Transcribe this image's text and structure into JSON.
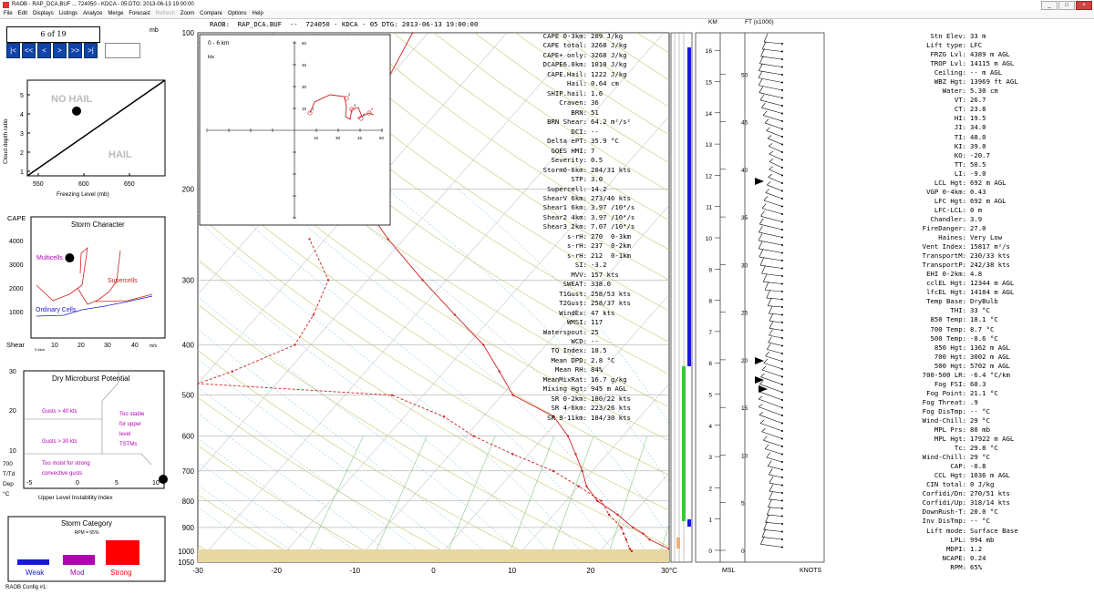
{
  "window": {
    "title": "RAOB - RAP_DCA.BUF ...  724050 - KDCA - 05  DTG: 2013-06-13 19:00:00",
    "controls": [
      "_",
      "□",
      "×"
    ]
  },
  "menu": [
    {
      "label": "File",
      "enabled": true
    },
    {
      "label": "Edit",
      "enabled": true
    },
    {
      "label": "Displays",
      "enabled": true
    },
    {
      "label": "Listings",
      "enabled": true
    },
    {
      "label": "Analyze",
      "enabled": true
    },
    {
      "label": "Merge",
      "enabled": true
    },
    {
      "label": "Forecast",
      "enabled": true
    },
    {
      "label": "Refresh",
      "enabled": false
    },
    {
      "label": "Zoom",
      "enabled": true
    },
    {
      "label": "Compare",
      "enabled": true
    },
    {
      "label": "Options",
      "enabled": true
    },
    {
      "label": "Help",
      "enabled": true
    }
  ],
  "frame": {
    "counter": "6 of 19",
    "unit": "mb",
    "nav": [
      "|<",
      "<<",
      "<",
      ">",
      ">>",
      ">|"
    ]
  },
  "header": "RAOB:  RAP_DCA.BUF  --  724050 - KDCA - 05 DTG: 2013-06-13 19:00:00",
  "hail_panel": {
    "no_hail": "NO HAIL",
    "hail": "HAIL",
    "ylabel": "Cloud depth ratio",
    "xlabel": "Freezing Level (mb)",
    "yticks": [
      "5",
      "4",
      "3",
      "2",
      "1"
    ],
    "xticks": [
      "550",
      "600",
      "650"
    ],
    "point": {
      "freezing_level": 592,
      "ratio": 4.15
    }
  },
  "storm_character": {
    "title": "Storm Character",
    "ylabel": "CAPE",
    "xlabel": "Shear",
    "xlabel_sub": "0-6km",
    "xunit": "m/s",
    "yticks": [
      "4000",
      "3000",
      "2000",
      "1000"
    ],
    "xticks": [
      "10",
      "20",
      "30",
      "40"
    ],
    "labels": {
      "multicells": "Multicells",
      "supercells": "Supercells",
      "ordinary": "Ordinary Cells"
    },
    "point": {
      "shear": 15.5,
      "cape": 3268
    }
  },
  "microburst": {
    "title": "Dry Microburst Potential",
    "g40": "Gusts > 40 kts",
    "g30": "Gusts > 30 kts",
    "stable": [
      "Too stable",
      "for upper",
      "level",
      "TSTMs"
    ],
    "moist": [
      "Too moist for strong",
      "convective gusts"
    ],
    "yticks": [
      "30",
      "20",
      "10"
    ],
    "xticks": [
      "-5",
      "0",
      "5",
      "10"
    ],
    "xlabel": "Upper Level Instability Index",
    "side": [
      "700",
      "T/Td",
      "Dep",
      "°C"
    ]
  },
  "storm_category": {
    "title": "Storm Category",
    "rpm": "RPM = 65%",
    "weak": "Weak",
    "mod": "Mod",
    "strong": "Strong"
  },
  "status": "RAOB Config #1:",
  "colors": {
    "weak": "#1a1ad0",
    "mod": "#b000b0",
    "strong": "#ff0000",
    "skewt_line": "#cc2222",
    "dry_adiabat": "#c8c870",
    "moist_adiabat": "#6ab0d8",
    "mixing_ratio": "#66bb66",
    "ground": "#e8d7a0"
  },
  "chart_data": {
    "type": "line",
    "title": "",
    "pressure_ticks": [
      "100",
      "200",
      "300",
      "400",
      "500",
      "600",
      "700",
      "800",
      "900",
      "1000",
      "1050"
    ],
    "temp_ticks": [
      "-30",
      "-20",
      "-10",
      "0",
      "10",
      "20",
      "30°C"
    ],
    "series": [
      {
        "name": "",
        "p": [
          1000,
          990,
          950,
          925,
          900,
          850,
          800,
          750,
          700,
          650,
          600,
          550,
          500,
          450,
          400,
          350,
          300,
          250,
          200,
          150,
          100
        ],
        "t": [
          30.5,
          28.5,
          25.0,
          23.5,
          21.5,
          18.1,
          14.0,
          11.0,
          8.7,
          6.0,
          3.0,
          -1.0,
          -8.6,
          -13.0,
          -18.0,
          -25.0,
          -33.0,
          -42.0,
          -52.0,
          -58.0,
          -62.0
        ]
      },
      {
        "name": "",
        "p": [
          1000,
          990,
          950,
          925,
          900,
          850,
          800,
          750,
          700,
          650,
          600,
          550,
          500,
          475,
          450,
          400,
          350,
          300,
          250
        ],
        "t": [
          24.0,
          23.5,
          22.0,
          21.0,
          20.0,
          17.0,
          14.5,
          10.0,
          5.0,
          -2.0,
          -9.0,
          -15.0,
          -24.0,
          -50.0,
          -47.0,
          -42.0,
          -43.0,
          -45.0,
          -52.0
        ]
      }
    ],
    "hodograph": {
      "title": "0 - 6 km",
      "unit": "kts",
      "ticks": [
        "15",
        "30",
        "45",
        "60"
      ],
      "labels": [
        "1",
        "2",
        "3",
        "4",
        "5"
      ]
    },
    "wind_height": {
      "km_label": "KM",
      "ft_label": "FT (x1000)",
      "msl": "MSL",
      "knots": "KNOTS",
      "km_ticks": [
        "16",
        "15",
        "14",
        "13",
        "12",
        "11",
        "10",
        "9",
        "8",
        "7",
        "6",
        "5",
        "4",
        "3",
        "2",
        "1",
        "0"
      ],
      "ft_ticks": [
        "50",
        "45",
        "40",
        "35",
        "30",
        "25",
        "20",
        "15",
        "10",
        "5",
        "0"
      ]
    }
  },
  "indices_left": [
    [
      "CAPE 0-3km:",
      "209 J/kg"
    ],
    [
      "CAPE total:",
      "3268 J/kg"
    ],
    [
      "CAPE+ only:",
      "3268 J/kg"
    ],
    [
      "DCAPE6.0km:",
      "1010 J/kg"
    ],
    [
      "CAPE.Hail:",
      "1222 J/kg"
    ],
    [
      "Hail:",
      "0.64 cm"
    ],
    [
      "SHIP.hail:",
      "1.6"
    ],
    [
      "Craven:",
      "36"
    ],
    [
      "BRN:",
      "51"
    ],
    [
      "BRN Shear:",
      "64.2 m²/s²"
    ],
    [
      "DCI:",
      "--"
    ],
    [
      "Delta ePT:",
      "35.9 °C"
    ],
    [
      "GOES HMI:",
      "7"
    ],
    [
      "Severity:",
      "0.5"
    ],
    [
      "Storm0-6km:",
      "284/31 kts"
    ],
    [
      "STP:",
      "3.0"
    ],
    [
      "Supercell:",
      "14.2"
    ],
    [
      "ShearV 6km:",
      "273/46 kts"
    ],
    [
      "Shear1 6km:",
      "3.97 /10⁴/s"
    ],
    [
      "Shear2 4km:",
      "3.97 /10⁴/s"
    ],
    [
      "Shear3 2km:",
      "7.07 /10⁴/s"
    ],
    [
      "s-rH:",
      "270  0-3km"
    ],
    [
      "s-rH:",
      "237  0-2km"
    ],
    [
      "s-rH:",
      "212  0-1km"
    ],
    [
      "SI:",
      "-3.2"
    ],
    [
      "MVV:",
      "157 kts"
    ],
    [
      "SWEAT:",
      "338.0"
    ],
    [
      "T1Gust:",
      "258/53 kts"
    ],
    [
      "T2Gust:",
      "258/37 kts"
    ],
    [
      "WindEx:",
      "47 kts"
    ],
    [
      "WMSI:",
      "117"
    ],
    [
      "Waterspout:",
      "25"
    ],
    [
      "WCD:",
      "--"
    ],
    [
      "TQ Index:",
      "18.5"
    ],
    [
      "Mean DPD:",
      "2.8 °C"
    ],
    [
      "Mean RH:",
      "84%"
    ],
    [
      "MeanMixRat:",
      "16.7 g/kg"
    ],
    [
      "Mixing Hgt:",
      "945 m AGL"
    ],
    [
      "SR 0-2km:",
      "180/22 kts"
    ],
    [
      "SR 4-6km:",
      "223/26 kts"
    ],
    [
      "SR 9-11km:",
      "184/30 kts"
    ]
  ],
  "indices_right": [
    [
      "Stn Elev:",
      "33 m"
    ],
    [
      "Lift type:",
      "LFC"
    ],
    [
      "FRZG Lvl:",
      "4389 m AGL"
    ],
    [
      "TROP Lvl:",
      "14115 m AGL"
    ],
    [
      "Ceiling:",
      "-- m AGL"
    ],
    [
      "WBZ Hgt:",
      "13969 ft AGL"
    ],
    [
      "Water:",
      "5.30 cm"
    ],
    [
      "VT:",
      "26.7"
    ],
    [
      "CT:",
      "23.8"
    ],
    [
      "HI:",
      "19.5"
    ],
    [
      "JI:",
      "34.0"
    ],
    [
      "TI:",
      "48.0"
    ],
    [
      "KI:",
      "39.0"
    ],
    [
      "KO:",
      "-20.7"
    ],
    [
      "TT:",
      "50.5"
    ],
    [
      "LI:",
      "-9.0"
    ],
    [
      "LCL Hgt:",
      "692 m AGL"
    ],
    [
      "VGP 0-4km:",
      "0.43"
    ],
    [
      "LFC Hgt:",
      "692 m AGL"
    ],
    [
      "LFC-LCL:",
      "0 m"
    ],
    [
      "Chandler:",
      "3.9"
    ],
    [
      "FireDanger:",
      "27.0"
    ],
    [
      "Haines:",
      "Very Low"
    ],
    [
      "Vent Index:",
      "15817 m²/s"
    ],
    [
      "TransportM:",
      "230/33 kts"
    ],
    [
      "TransportP:",
      "242/38 kts"
    ],
    [
      "EHI 0-2km:",
      "4.8"
    ],
    [
      "cclEL Hgt:",
      "12344 m AGL"
    ],
    [
      "lfcEL Hgt:",
      "14184 m AGL"
    ],
    [
      "Temp Base:",
      "DryBulb"
    ],
    [
      "THI:",
      "33 °C"
    ],
    [
      "850 Temp:",
      "18.1 °C"
    ],
    [
      "700 Temp:",
      "8.7 °C"
    ],
    [
      "500 Temp:",
      "-8.6 °C"
    ],
    [
      "850 Hgt:",
      "1362 m AGL"
    ],
    [
      "700 Hgt:",
      "3002 m AGL"
    ],
    [
      "500 Hgt:",
      "5702 m AGL"
    ],
    [
      "700-500 LR:",
      "-6.4 °C/km"
    ],
    [
      "Fog FSI:",
      "68.3"
    ],
    [
      "Fog Point:",
      "21.1 °C"
    ],
    [
      "Fog Threat:",
      ".9"
    ],
    [
      "Fog DisTmp:",
      "-- °C"
    ],
    [
      "Wind-Chill:",
      "29 °C"
    ],
    [
      "MPL Prs:",
      "80 mb"
    ],
    [
      "MPL Hgt:",
      "17922 m AGL"
    ],
    [
      "Tc:",
      "29.8 °C"
    ],
    [
      "Wind-Chill:",
      "29 °C"
    ],
    [
      "CAP:",
      "-0.8"
    ],
    [
      "CCL Hgt:",
      "1036 m AGL"
    ],
    [
      "CIN total:",
      "0 J/kg"
    ],
    [
      "Corfidi/Dn:",
      "270/51 kts"
    ],
    [
      "Corfidi/Up:",
      "318/14 kts"
    ],
    [
      "DownRush-T:",
      "20.0 °C"
    ],
    [
      "Inv DisTmp:",
      "-- °C"
    ],
    [
      "Lift mode:",
      "Surface Base"
    ],
    [
      "LPL:",
      "994 mb"
    ],
    [
      "MDPI:",
      "1.2"
    ],
    [
      "NCAPE:",
      "0.24"
    ],
    [
      "RPM:",
      "65%"
    ]
  ]
}
